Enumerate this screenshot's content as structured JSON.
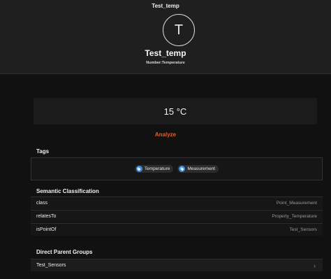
{
  "header": {
    "title": "Test_temp",
    "avatar_letter": "T",
    "name": "Test_temp",
    "subtitle": "Number:Temperature"
  },
  "value": {
    "display": "15 °C"
  },
  "analyze_label": "Analyze",
  "tags": {
    "title": "Tags",
    "items": [
      {
        "label": "Temperature",
        "icon": "tag-icon"
      },
      {
        "label": "Measurement",
        "icon": "tag-icon"
      }
    ]
  },
  "semantic": {
    "title": "Semantic Classification",
    "rows": [
      {
        "key": "class",
        "value": "Point_Measurement"
      },
      {
        "key": "relatesTo",
        "value": "Property_Temperature"
      },
      {
        "key": "isPointOf",
        "value": "Test_Sensors"
      }
    ]
  },
  "parents": {
    "title": "Direct Parent Groups",
    "items": [
      {
        "label": "Test_Sensors",
        "icon": "chevron-right-icon"
      }
    ]
  },
  "colors": {
    "accent": "#e0612c",
    "tag_icon": "#3a8ee6"
  }
}
